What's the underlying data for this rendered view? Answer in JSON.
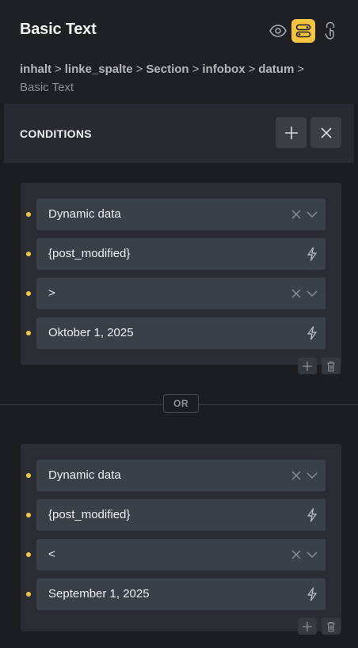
{
  "header": {
    "title": "Basic Text",
    "icons": [
      "eye-icon",
      "conditions-icon",
      "touch-icon"
    ],
    "accent_color": "#f5c542"
  },
  "breadcrumb": {
    "items": [
      "inhalt",
      "linke_spalte",
      "Section",
      "infobox",
      "datum"
    ],
    "current": "Basic Text",
    "separator": ">"
  },
  "conditions": {
    "title": "CONDITIONS"
  },
  "groups": [
    {
      "rows": [
        {
          "value": "Dynamic data",
          "kind": "select"
        },
        {
          "value": "{post_modified}",
          "kind": "dynamic"
        },
        {
          "value": ">",
          "kind": "select"
        },
        {
          "value": "Oktober 1, 2025",
          "kind": "dynamic"
        }
      ]
    },
    {
      "rows": [
        {
          "value": "Dynamic data",
          "kind": "select"
        },
        {
          "value": "{post_modified}",
          "kind": "dynamic"
        },
        {
          "value": "<",
          "kind": "select"
        },
        {
          "value": "September 1, 2025",
          "kind": "dynamic"
        }
      ]
    }
  ],
  "or_label": "OR"
}
